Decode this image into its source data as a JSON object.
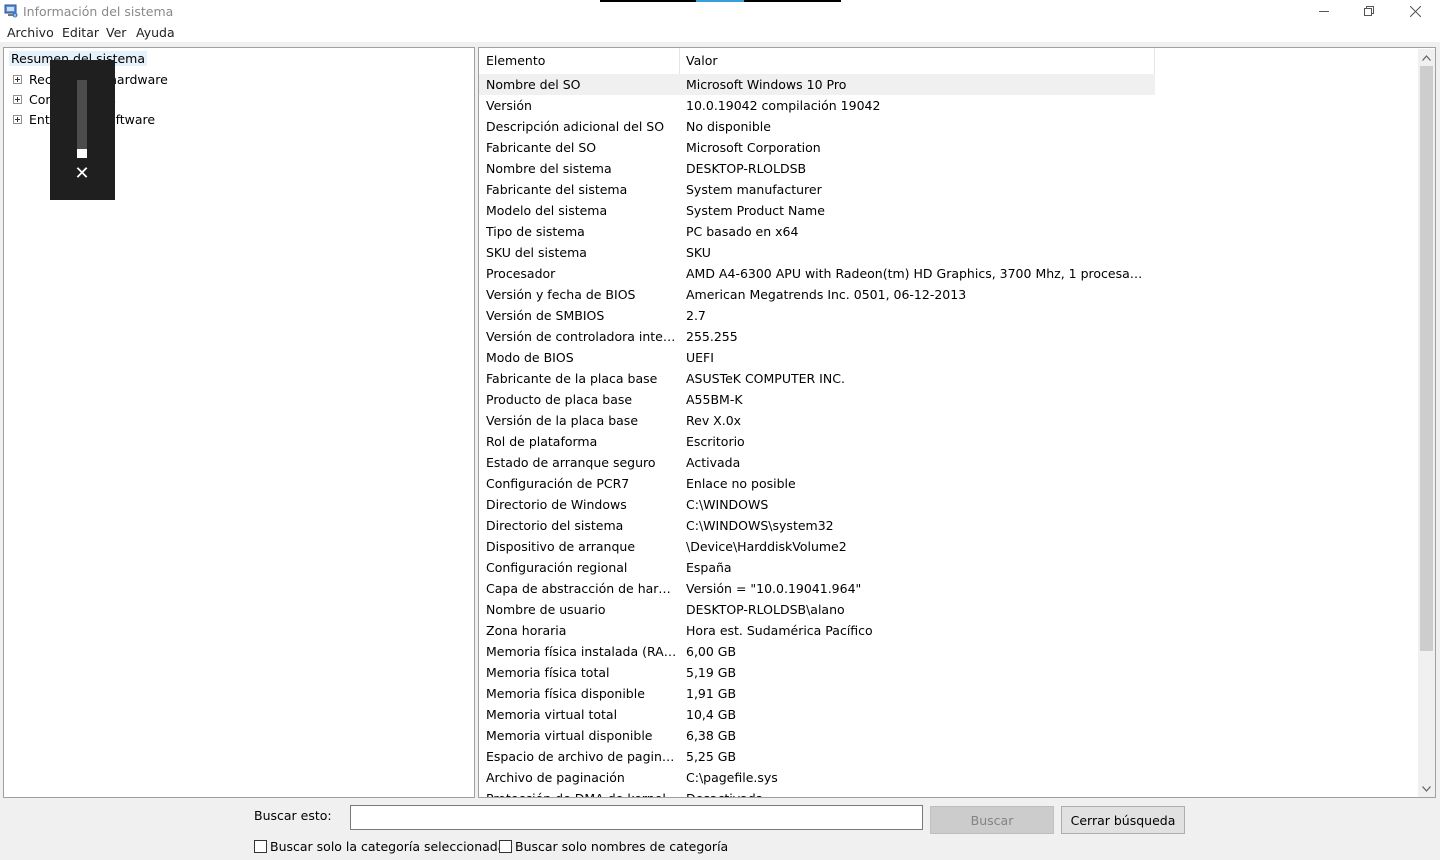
{
  "window": {
    "title": "Información del sistema",
    "top_strip_colors": [
      "#000000",
      "#38a0d8",
      "#000000"
    ]
  },
  "menu": [
    {
      "label": "Archivo"
    },
    {
      "label": "Editar"
    },
    {
      "label": "Ver"
    },
    {
      "label": "Ayuda"
    }
  ],
  "tree": {
    "root": "Resumen del sistema",
    "children": [
      {
        "label": "Recursos de hardware",
        "icon": "expand-plus-icon"
      },
      {
        "label": "Componentes",
        "icon": "expand-plus-icon"
      },
      {
        "label": "Entorno de software",
        "icon": "expand-plus-icon"
      }
    ]
  },
  "volume_overlay": {
    "level": 0.12,
    "close_symbol": "✕"
  },
  "list": {
    "columns": [
      "Elemento",
      "Valor"
    ],
    "rows": [
      {
        "item": "Nombre del SO",
        "value": "Microsoft Windows 10 Pro"
      },
      {
        "item": "Versión",
        "value": "10.0.19042 compilación 19042"
      },
      {
        "item": "Descripción adicional del SO",
        "value": "No disponible"
      },
      {
        "item": "Fabricante del SO",
        "value": "Microsoft Corporation"
      },
      {
        "item": "Nombre del sistema",
        "value": "DESKTOP-RLOLDSB"
      },
      {
        "item": "Fabricante del sistema",
        "value": "System manufacturer"
      },
      {
        "item": "Modelo del sistema",
        "value": "System Product Name"
      },
      {
        "item": "Tipo de sistema",
        "value": "PC basado en x64"
      },
      {
        "item": "SKU del sistema",
        "value": "SKU"
      },
      {
        "item": "Procesador",
        "value": "AMD A4-6300 APU with Radeon(tm) HD Graphics, 3700 Mhz, 1 procesadores ..."
      },
      {
        "item": "Versión y fecha de BIOS",
        "value": "American Megatrends Inc. 0501, 06-12-2013"
      },
      {
        "item": "Versión de SMBIOS",
        "value": "2.7"
      },
      {
        "item": "Versión de controladora integr...",
        "value": "255.255"
      },
      {
        "item": "Modo de BIOS",
        "value": "UEFI"
      },
      {
        "item": "Fabricante de la placa base",
        "value": "ASUSTeK COMPUTER INC."
      },
      {
        "item": "Producto de placa base",
        "value": "A55BM-K"
      },
      {
        "item": "Versión de la placa base",
        "value": "Rev X.0x"
      },
      {
        "item": "Rol de plataforma",
        "value": "Escritorio"
      },
      {
        "item": "Estado de arranque seguro",
        "value": "Activada"
      },
      {
        "item": "Configuración de PCR7",
        "value": "Enlace no posible"
      },
      {
        "item": "Directorio de Windows",
        "value": "C:\\WINDOWS"
      },
      {
        "item": "Directorio del sistema",
        "value": "C:\\WINDOWS\\system32"
      },
      {
        "item": "Dispositivo de arranque",
        "value": "\\Device\\HarddiskVolume2"
      },
      {
        "item": "Configuración regional",
        "value": "España"
      },
      {
        "item": "Capa de abstracción de hardw...",
        "value": "Versión = \"10.0.19041.964\""
      },
      {
        "item": "Nombre de usuario",
        "value": "DESKTOP-RLOLDSB\\alano"
      },
      {
        "item": "Zona horaria",
        "value": "Hora est. Sudamérica Pacífico"
      },
      {
        "item": "Memoria física instalada (RAM)",
        "value": "6,00 GB"
      },
      {
        "item": "Memoria física total",
        "value": "5,19 GB"
      },
      {
        "item": "Memoria física disponible",
        "value": "1,91 GB"
      },
      {
        "item": "Memoria virtual total",
        "value": "10,4 GB"
      },
      {
        "item": "Memoria virtual disponible",
        "value": "6,38 GB"
      },
      {
        "item": "Espacio de archivo de paginaci...",
        "value": "5,25 GB"
      },
      {
        "item": "Archivo de paginación",
        "value": "C:\\pagefile.sys"
      },
      {
        "item": "Protección de DMA de kernel",
        "value": "Desactivada"
      }
    ],
    "scroll": {
      "position": 0,
      "visible_fraction": 0.82
    }
  },
  "search": {
    "label": "Buscar esto:",
    "value": "",
    "find_button": "Buscar",
    "close_button": "Cerrar búsqueda",
    "check_selected_category": {
      "label": "Buscar solo la categoría seleccionada",
      "checked": false
    },
    "check_category_names": {
      "label": "Buscar solo nombres de categoría",
      "checked": false
    }
  }
}
